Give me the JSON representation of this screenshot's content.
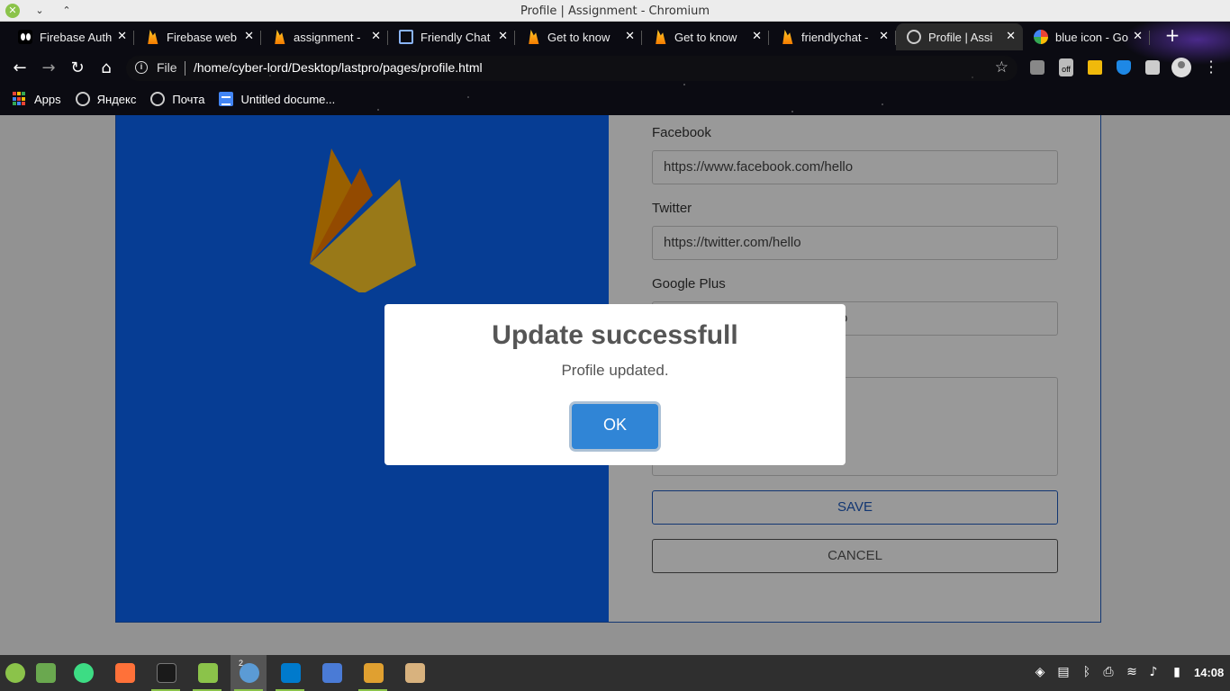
{
  "window": {
    "title": "Profile | Assignment - Chromium",
    "controls": {
      "close": "✕",
      "minimize": "⌄",
      "maximize": "⌃"
    }
  },
  "tabs": [
    {
      "label": "Firebase Auth",
      "icon": "firebase-auth-icon",
      "active": false
    },
    {
      "label": "Firebase web",
      "icon": "firebase-icon",
      "active": false
    },
    {
      "label": "assignment -",
      "icon": "firebase-icon",
      "active": false
    },
    {
      "label": "Friendly Chat",
      "icon": "chat-icon",
      "active": false
    },
    {
      "label": "Get to know",
      "icon": "firebase-icon",
      "active": false
    },
    {
      "label": "Get to know",
      "icon": "firebase-icon",
      "active": false
    },
    {
      "label": "friendlychat -",
      "icon": "firebase-icon",
      "active": false
    },
    {
      "label": "Profile | Assi",
      "icon": "globe-icon",
      "active": true
    },
    {
      "label": "blue icon - Go",
      "icon": "google-icon",
      "active": false
    }
  ],
  "tab_close_glyph": "✕",
  "new_tab_glyph": "+",
  "toolbar": {
    "back": "←",
    "forward": "→",
    "reload": "↻",
    "home": "⌂",
    "scheme_label": "File",
    "url": "/home/cyber-lord/Desktop/lastpro/pages/profile.html",
    "bookmark_star": "☆",
    "ext_badge": "off"
  },
  "bookmarks": [
    {
      "label": "Apps",
      "icon": "apps-grid-icon"
    },
    {
      "label": "Яндекс",
      "icon": "globe-icon"
    },
    {
      "label": "Почта",
      "icon": "globe-icon"
    },
    {
      "label": "Untitled docume...",
      "icon": "google-docs-icon"
    }
  ],
  "form": {
    "facebook_label": "Facebook",
    "facebook_value": "https://www.facebook.com/hello",
    "twitter_label": "Twitter",
    "twitter_value": "https://twitter.com/hello",
    "googleplus_label": "Google Plus",
    "googleplus_value_visible": "o",
    "save_label": "SAVE",
    "cancel_label": "CANCEL"
  },
  "modal": {
    "title": "Update successfull",
    "text": "Profile updated.",
    "ok_label": "OK"
  },
  "taskbar": {
    "apps": [
      "mint-menu-icon",
      "show-desktop-icon",
      "android-studio-icon",
      "firefox-icon",
      "terminal-icon",
      "files-icon",
      "chromium-icon",
      "vscode-icon",
      "git-kraken-icon",
      "sublime-text-icon",
      "archive-icon"
    ],
    "chromium_badge": "2",
    "clock": "14:08"
  },
  "colors": {
    "firebase_blue": "#0b67f7",
    "modal_ok": "#3085d6",
    "save_border": "#1f5bbf"
  }
}
